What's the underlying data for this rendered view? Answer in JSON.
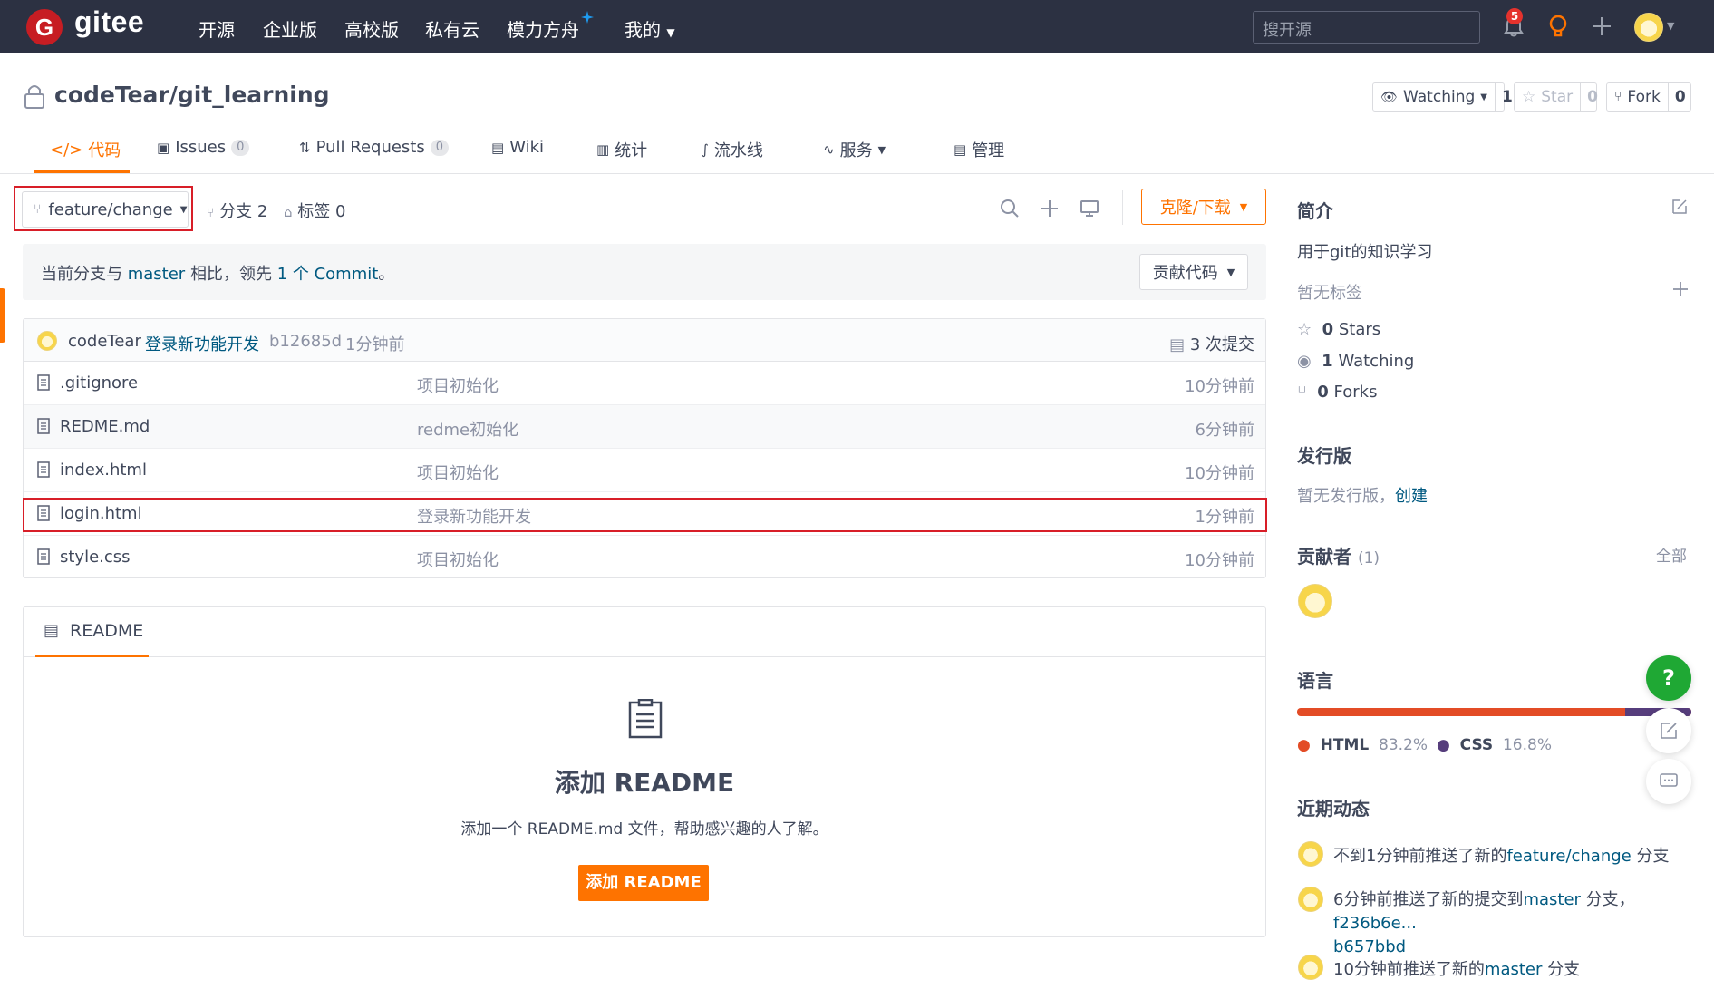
{
  "topnav": {
    "logo_letter": "G",
    "logo_text": "gitee",
    "items": [
      "开源",
      "企业版",
      "高校版",
      "私有云",
      "模力方舟",
      "我的"
    ],
    "search_placeholder": "搜开源",
    "notification_count": "5"
  },
  "repo": {
    "title": "codeTear/git_learning",
    "watching_label": "Watching",
    "watching_count": "1",
    "star_label": "Star",
    "star_count": "0",
    "fork_label": "Fork",
    "fork_count": "0"
  },
  "tabs": [
    {
      "label": "代码"
    },
    {
      "label": "Issues",
      "count": "0"
    },
    {
      "label": "Pull Requests",
      "count": "0"
    },
    {
      "label": "Wiki"
    },
    {
      "label": "统计"
    },
    {
      "label": "流水线"
    },
    {
      "label": "服务"
    },
    {
      "label": "管理"
    }
  ],
  "branch": {
    "current": "feature/change",
    "branches_label": "分支 2",
    "tags_label": "标签 0",
    "clone_label": "克隆/下载",
    "compare_prefix": "当前分支与",
    "compare_branch": "master",
    "compare_mid": "相比，领先",
    "compare_commits": "1 个 Commit",
    "compare_suffix": "。",
    "contribute_label": "贡献代码"
  },
  "commit": {
    "author": "codeTear",
    "message": "登录新功能开发",
    "hash": "b12685d",
    "time": "1分钟前",
    "total": "3 次提交"
  },
  "files": [
    {
      "name": ".gitignore",
      "message": "项目初始化",
      "time": "10分钟前"
    },
    {
      "name": "REDME.md",
      "message": "redme初始化",
      "time": "6分钟前"
    },
    {
      "name": "index.html",
      "message": "项目初始化",
      "time": "10分钟前"
    },
    {
      "name": "login.html",
      "message": "登录新功能开发",
      "time": "1分钟前"
    },
    {
      "name": "style.css",
      "message": "项目初始化",
      "time": "10分钟前"
    }
  ],
  "readme": {
    "tab_label": "README",
    "heading": "添加 README",
    "desc": "添加一个 README.md 文件，帮助感兴趣的人了解。",
    "button": "添加 README"
  },
  "sidebar": {
    "intro_title": "简介",
    "intro_text": "用于git的知识学习",
    "no_tags": "暂无标签",
    "stars": {
      "count": "0",
      "label": "Stars"
    },
    "watching": {
      "count": "1",
      "label": "Watching"
    },
    "forks": {
      "count": "0",
      "label": "Forks"
    },
    "release_title": "发行版",
    "release_text": "暂无发行版，",
    "release_create": "创建",
    "contributors_title": "贡献者",
    "contributors_count": "(1)",
    "contributors_all": "全部",
    "language_title": "语言",
    "languages": [
      {
        "name": "HTML",
        "percent": "83.2%",
        "color": "#e34c26"
      },
      {
        "name": "CSS",
        "percent": "16.8%",
        "color": "#563d7c"
      }
    ],
    "activity_title": "近期动态",
    "activities": [
      {
        "prefix": "不到1分钟前推送了新的",
        "link": "feature/change",
        "suffix": "分支"
      },
      {
        "prefix": "6分钟前推送了新的提交到",
        "link": "master",
        "suffix": "分支，",
        "link2": "f236b6e...",
        "line2": "b657bbd"
      },
      {
        "prefix": "10分钟前推送了新的",
        "link": "master",
        "suffix": "分支"
      }
    ]
  },
  "colors": {
    "accent": "#fe7300",
    "nav_bg": "#2c3142",
    "link": "#005980",
    "highlight_box": "#d81e28",
    "help_green": "#1fa834"
  }
}
